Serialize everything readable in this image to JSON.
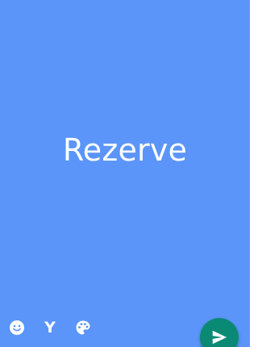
{
  "status": {
    "text": "Rezerve",
    "background_color": "#5b95fa",
    "text_color": "#ffffff"
  },
  "toolbar": {
    "emoji_icon": "smiley-face-icon",
    "font_toggle_label": "Y",
    "color_icon": "palette-icon"
  },
  "send": {
    "icon": "send-arrow-icon",
    "fab_color": "#0a8a74"
  }
}
